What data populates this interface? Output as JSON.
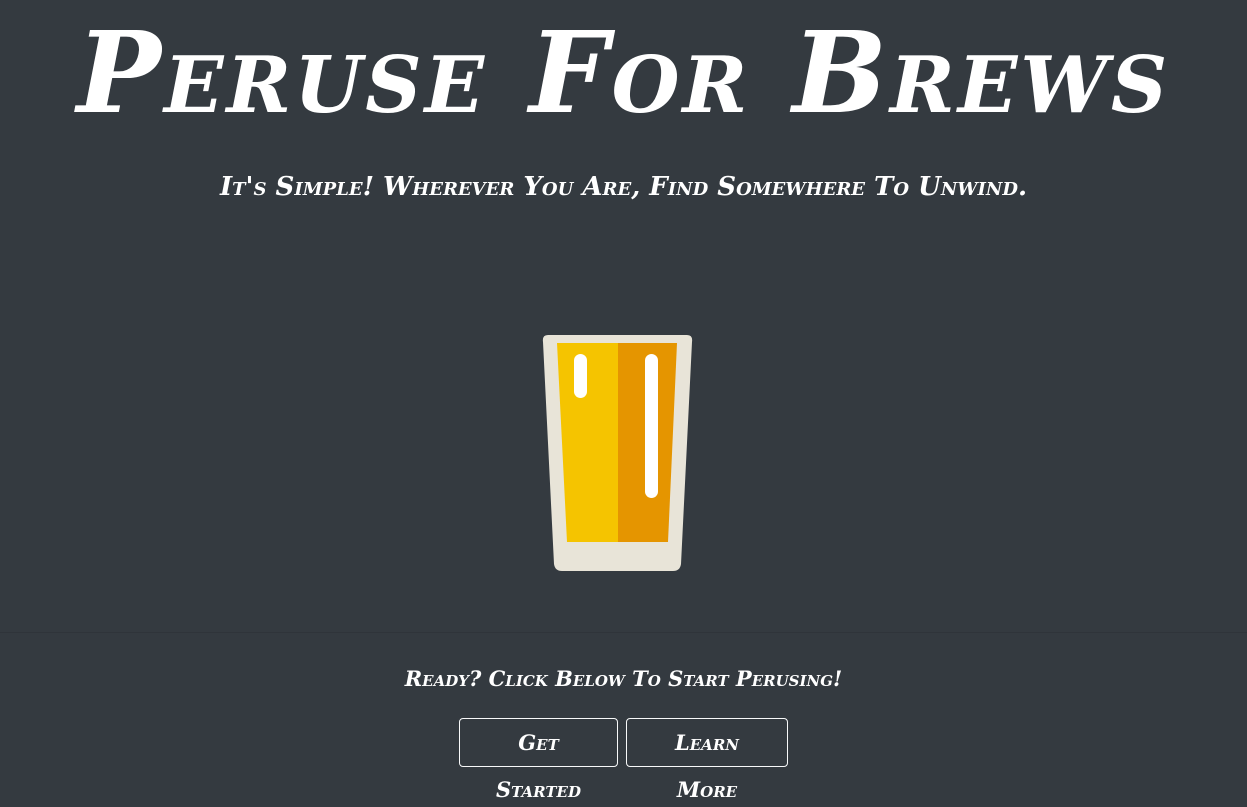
{
  "hero": {
    "title": "Peruse For Brews",
    "subtitle": "It's Simple! Wherever You Are, Find Somewhere To Unwind."
  },
  "illustration": {
    "icon": "beer-glass-icon",
    "colors": {
      "glass": "#e8e4d8",
      "beer_light": "#f5c400",
      "beer_dark": "#e59500",
      "highlight": "#ffffff"
    }
  },
  "cta": {
    "text": "Ready? Click Below To Start Perusing!",
    "buttons": {
      "get_started": "Get Started",
      "learn_more": "Learn More"
    }
  },
  "theme": {
    "background": "#343a40",
    "text": "#ffffff"
  }
}
